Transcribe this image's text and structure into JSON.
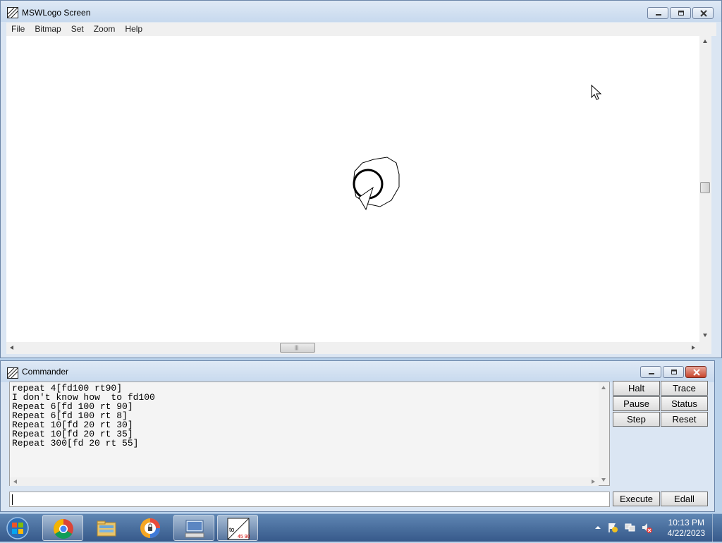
{
  "main_window": {
    "title": "MSWLogo Screen",
    "menu": [
      "File",
      "Bitmap",
      "Set",
      "Zoom",
      "Help"
    ]
  },
  "commander": {
    "title": "Commander",
    "history": [
      "repeat 4[fd100 rt90]",
      "I don't know how  to fd100",
      "Repeat 6[fd 100 rt 90]",
      "Repeat 6[fd 100 rt 8]",
      "Repeat 10[fd 20 rt 30]",
      "Repeat 10[fd 20 rt 35]",
      "Repeat 300[fd 20 rt 55]"
    ],
    "buttons": {
      "halt": "Halt",
      "trace": "Trace",
      "pause": "Pause",
      "status": "Status",
      "step": "Step",
      "reset": "Reset",
      "execute": "Execute",
      "edall": "Edall"
    },
    "input_value": ""
  },
  "taskbar": {
    "items": [
      "chrome-icon",
      "file-explorer-icon",
      "vpn-app-icon",
      "keyboard-app-icon",
      "mswlogo-icon"
    ],
    "clock_time": "10:13 PM",
    "clock_date": "4/22/2023"
  }
}
